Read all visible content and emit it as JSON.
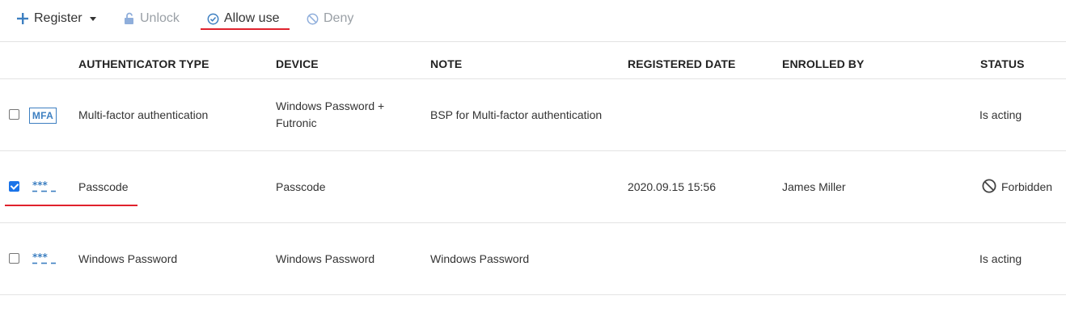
{
  "toolbar": {
    "register_label": "Register",
    "unlock_label": "Unlock",
    "allow_label": "Allow use",
    "deny_label": "Deny"
  },
  "columns": {
    "type": "AUTHENTICATOR TYPE",
    "device": "DEVICE",
    "note": "NOTE",
    "registered": "REGISTERED DATE",
    "enrolled": "ENROLLED BY",
    "status": "STATUS"
  },
  "rows": [
    {
      "checked": false,
      "icon": "mfa-icon",
      "icon_text": "MFA",
      "type": "Multi-factor authentication",
      "device_line1": "Windows Password +",
      "device_line2": "Futronic",
      "note": "BSP for Multi-factor authentication",
      "registered": "",
      "enrolled_by": "",
      "status": "Is acting"
    },
    {
      "checked": true,
      "icon": "password-icon",
      "type": "Passcode",
      "device": "Passcode",
      "note": "",
      "registered": "2020.09.15 15:56",
      "enrolled_by": "James Miller",
      "status": "Forbidden",
      "status_icon": "forbidden-icon"
    },
    {
      "checked": false,
      "icon": "password-icon",
      "type": "Windows Password",
      "device": "Windows Password",
      "note": "Windows Password",
      "registered": "",
      "enrolled_by": "",
      "status": "Is acting"
    }
  ],
  "colors": {
    "accent_blue": "#3d7fc1",
    "highlight_red": "#e0222d",
    "disabled_gray": "#9aa0a6",
    "checkbox_blue": "#1a73e8"
  }
}
